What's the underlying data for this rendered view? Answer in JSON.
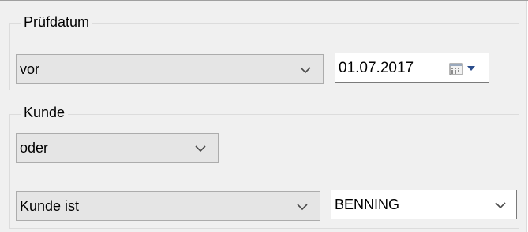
{
  "pruefdatum": {
    "label": "Prüfdatum",
    "operator": {
      "value": "vor"
    },
    "date": {
      "value": "01.07.2017"
    }
  },
  "kunde": {
    "label": "Kunde",
    "logic": {
      "value": "oder"
    },
    "condition": {
      "value": "Kunde ist"
    },
    "value_select": {
      "value": "BENNING"
    }
  },
  "icons": {
    "calendar": "calendar-icon",
    "dropdown_arrow": "dropdown-arrow-icon",
    "chevron": "chevron-down-icon"
  }
}
